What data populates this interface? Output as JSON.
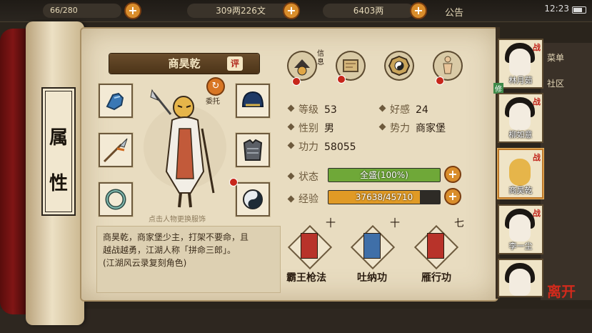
{
  "topbar": {
    "stamina": "66/280",
    "silver": "309两226文",
    "gold": "6403两",
    "announcement": "公告",
    "time": "12:23"
  },
  "panel": {
    "title_chars": [
      "属",
      "性"
    ]
  },
  "character": {
    "name": "商昊乾",
    "eval_label": "评",
    "change_label": "委托",
    "tap_hint": "点击人物更换服饰",
    "description_lines": [
      "商昊乾，商家堡少主，打架不要命，且",
      "越战越勇，江湖人称「拼命三郎」。",
      "(江湖风云录复刻角色)"
    ]
  },
  "actions": {
    "info_label": "信息"
  },
  "stats": {
    "level_label": "等级",
    "level": "53",
    "favor_label": "好感",
    "favor": "24",
    "gender_label": "性别",
    "gender": "男",
    "faction_label": "势力",
    "faction": "商家堡",
    "power_label": "功力",
    "power": "58055",
    "state_label": "状态",
    "state_value": "全盛(100%)",
    "state_fraction": 1.0,
    "exp_label": "经验",
    "exp_value": "37638/45710",
    "exp_fraction": 0.823
  },
  "skills": [
    {
      "name": "霸王枪法",
      "level": "十"
    },
    {
      "name": "吐纳功",
      "level": "十"
    },
    {
      "name": "雁行功",
      "level": "七"
    }
  ],
  "roster": [
    {
      "name": "林月茹",
      "battle": "战",
      "tag": "修"
    },
    {
      "name": "柳如意",
      "battle": "战",
      "tag": ""
    },
    {
      "name": "商昊乾",
      "battle": "战",
      "tag": ""
    },
    {
      "name": "李一尘",
      "battle": "战",
      "tag": ""
    },
    {
      "name": "",
      "battle": "",
      "tag": ""
    }
  ],
  "side_menu": [
    "菜单",
    "社区"
  ],
  "leave_label": "离开",
  "colors": {
    "state_bar": "#6fa838",
    "exp_bar": "#e09a25",
    "accent_red": "#c0231a"
  }
}
